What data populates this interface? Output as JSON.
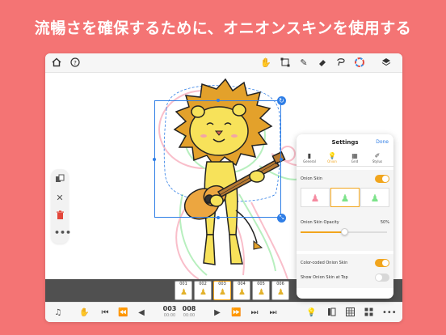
{
  "headline": "流暢さを確保するために、オニオンスキンを使用する",
  "colors": {
    "background": "#f47474",
    "accent": "#f1a51d",
    "selection": "#2f7ee6",
    "onion_red": "#f58aa0",
    "onion_green": "#7de38a"
  },
  "top_toolbar": {
    "left_icons": [
      "home-icon",
      "help-icon"
    ],
    "right_icons": [
      "hand-tool-icon",
      "transform-icon",
      "pen-icon",
      "eraser-icon",
      "lasso-icon",
      "color-wheel-icon",
      "layers-icon"
    ]
  },
  "left_panel": {
    "icons": [
      "copy-icon",
      "close-icon",
      "trash-icon",
      "more-icon"
    ]
  },
  "timeline": {
    "frames": [
      {
        "label": "001"
      },
      {
        "label": "002"
      },
      {
        "label": "003"
      },
      {
        "label": "004"
      },
      {
        "label": "005"
      },
      {
        "label": "006"
      }
    ]
  },
  "bottom_toolbar": {
    "current_frame": "003",
    "current_time": "00:00",
    "total_frames": "008",
    "total_time": "00:00"
  },
  "settings": {
    "title": "Settings",
    "done_label": "Done",
    "tabs": [
      {
        "label": "General",
        "icon": "phone-icon",
        "active": false
      },
      {
        "label": "Onion",
        "icon": "bulb-icon",
        "active": true
      },
      {
        "label": "Grid",
        "icon": "grid-icon",
        "active": false
      },
      {
        "label": "Stylus",
        "icon": "stylus-icon",
        "active": false
      }
    ],
    "onion_skin_label": "Onion Skin",
    "onion_skin_on": true,
    "skin_options": [
      "before",
      "both",
      "after"
    ],
    "skin_selected": "both",
    "opacity_label": "Onion Skin Opacity",
    "opacity_value": "50%",
    "opacity_fraction": 0.5,
    "color_coded_label": "Color-coded Onion Skin",
    "color_coded_on": true,
    "show_top_label": "Show Onion Skin at Top",
    "show_top_on": false
  }
}
